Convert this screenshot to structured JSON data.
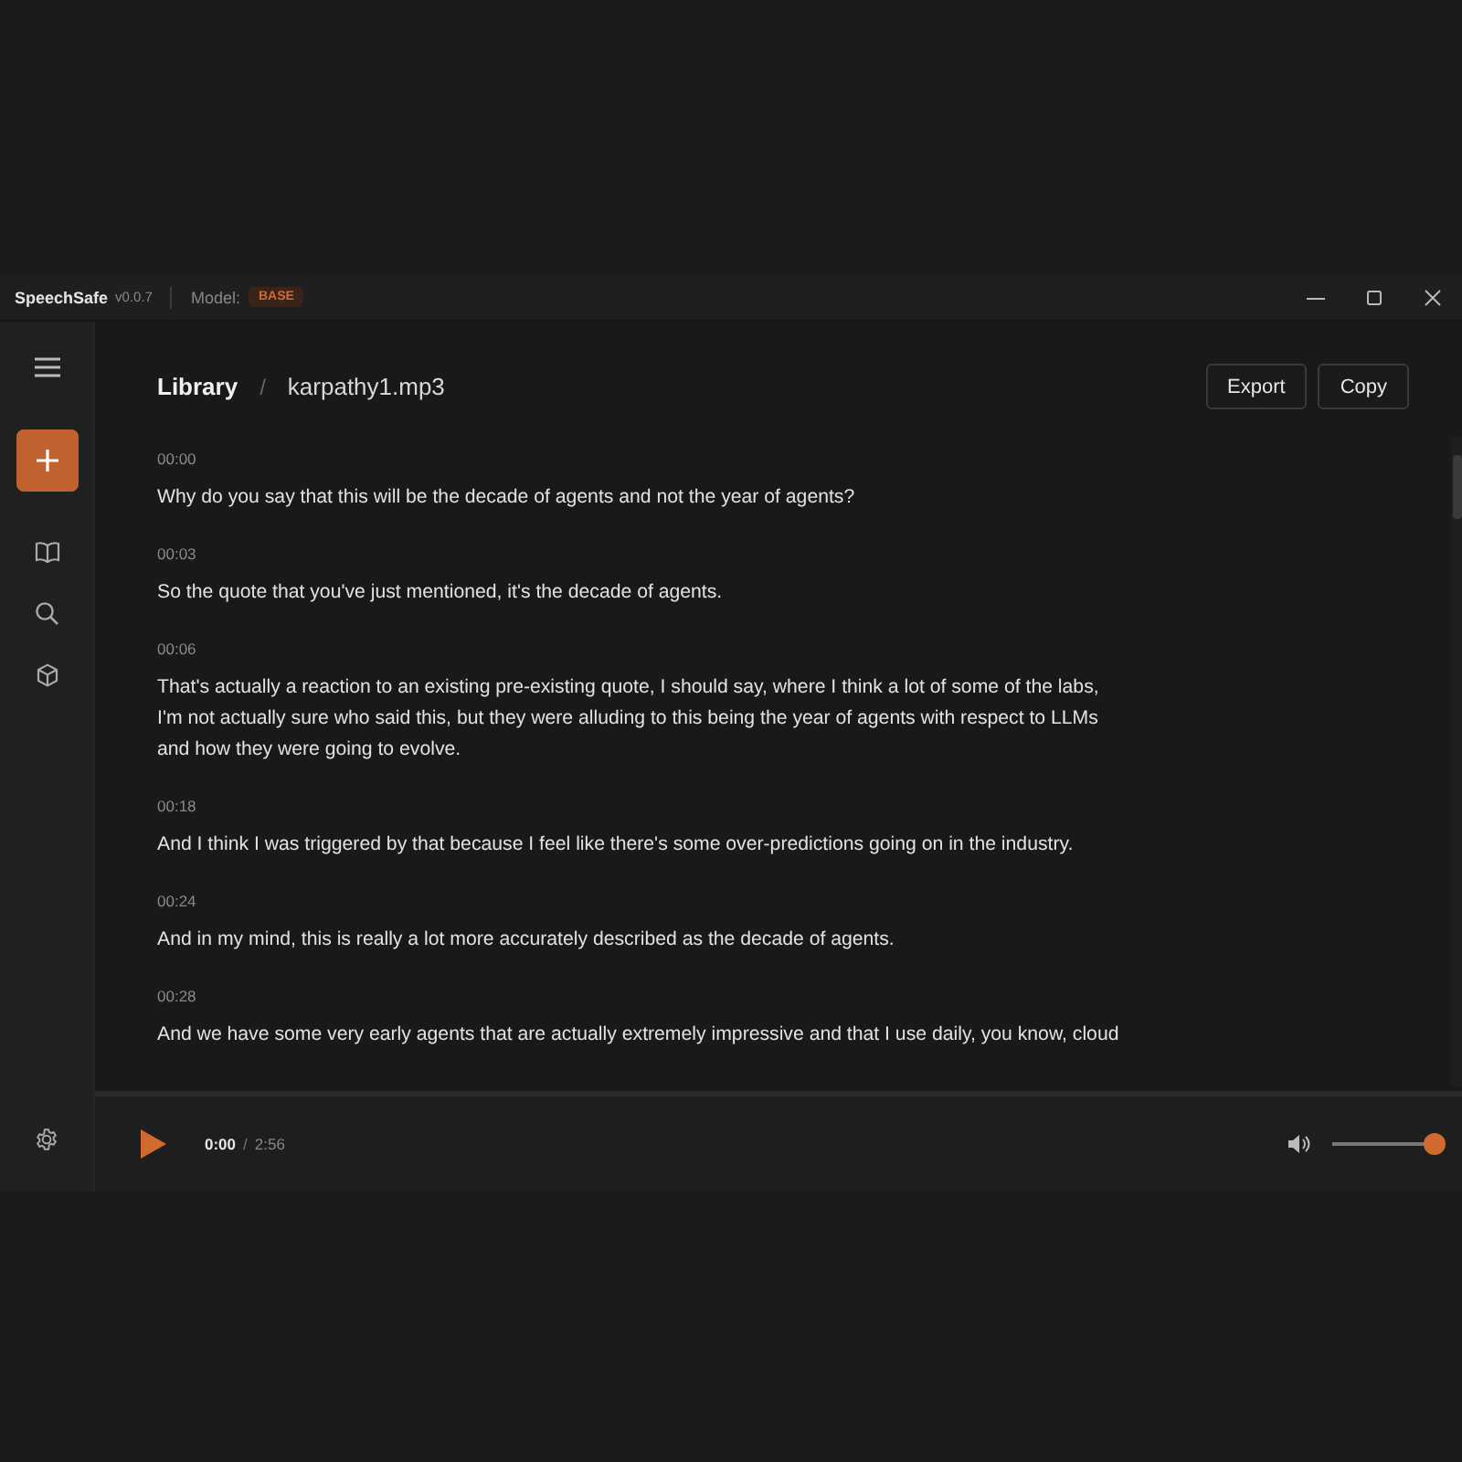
{
  "titlebar": {
    "app_name": "SpeechSafe",
    "version": "v0.0.7",
    "model_label": "Model:",
    "model_badge": "BASE"
  },
  "breadcrumb": {
    "root": "Library",
    "separator": "/",
    "file": "karpathy1.mp3"
  },
  "actions": [
    "Export",
    "Copy"
  ],
  "segments": [
    {
      "time": "00:00",
      "text": "Why do you say that this will be the decade of agents and not the year of agents?"
    },
    {
      "time": "00:03",
      "text": "So the quote that you've just mentioned, it's the decade of agents."
    },
    {
      "time": "00:06",
      "text": "That's actually a reaction to an existing pre-existing quote, I should say, where I think a lot of some of the labs, I'm not actually sure who said this, but they were alluding to this being the year of agents with respect to LLMs and how they were going to evolve."
    },
    {
      "time": "00:18",
      "text": "And I think I was triggered by that because I feel like there's some over-predictions going on in the industry."
    },
    {
      "time": "00:24",
      "text": "And in my mind, this is really a lot more accurately described as the decade of agents."
    },
    {
      "time": "00:28",
      "text": "And we have some very early agents that are actually extremely impressive and that I use daily, you know, cloud"
    }
  ],
  "player": {
    "current": "0:00",
    "separator": "/",
    "duration": "2:56",
    "volume": {
      "level": 1
    }
  }
}
